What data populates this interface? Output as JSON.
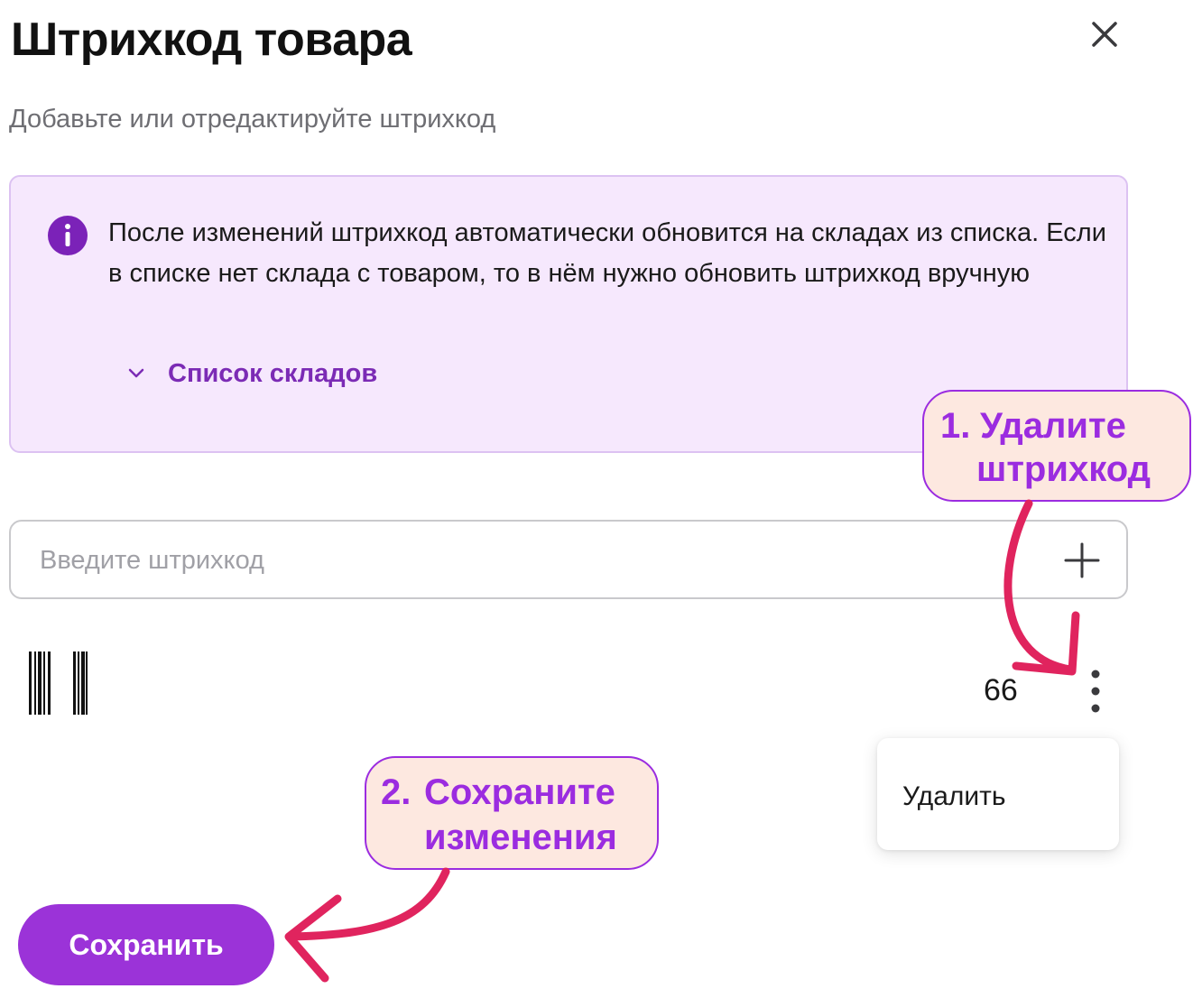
{
  "dialog": {
    "title": "Штрихкод товара",
    "subtitle": "Добавьте или отредактируйте штрихкод"
  },
  "info": {
    "text": "После изменений штрихкод автоматически обновится на складах из списка. Если в списке нет склада с товаром, то в нём нужно обновить штрихкод вручную",
    "warehouses_toggle": "Список складов",
    "icon": "info-icon"
  },
  "barcode_input": {
    "placeholder": "Введите штрихкод",
    "value": "",
    "add_icon": "plus-icon"
  },
  "barcode_item": {
    "value": "66",
    "icon": "barcode-icon",
    "more_icon": "vertical-dots-icon"
  },
  "context_menu": {
    "items": [
      "Удалить"
    ]
  },
  "actions": {
    "save_label": "Сохранить"
  },
  "annotations": {
    "step1": {
      "num": "1.",
      "line1": "Удалите",
      "line2": "штрихкод"
    },
    "step2": {
      "num": "2.",
      "line1": "Сохраните",
      "line2": "изменения"
    }
  },
  "colors": {
    "accent": "#9b33d8",
    "info_bg": "#f6e8fd",
    "callout_bg": "#fde8e0",
    "callout_text": "#9b2ce0",
    "arrow": "#e0245e"
  }
}
